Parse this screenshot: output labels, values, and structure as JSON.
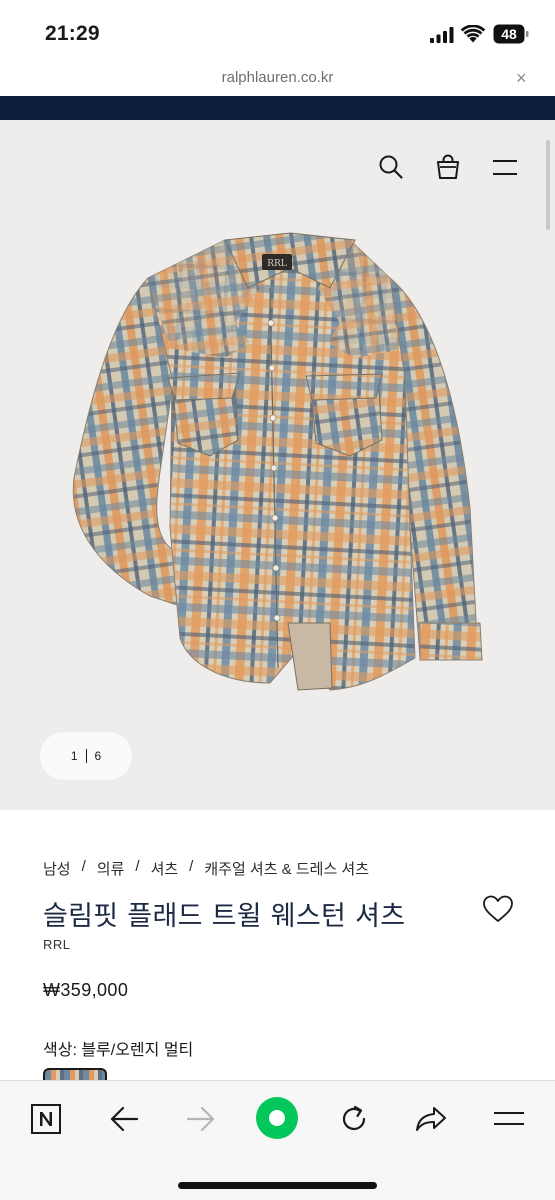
{
  "status_bar": {
    "time": "21:29",
    "battery": "48"
  },
  "url_bar": {
    "domain": "ralphlauren.co.kr",
    "close_glyph": "×"
  },
  "hero": {
    "icons": [
      "search-icon",
      "shopping-bag-icon",
      "menu-icon"
    ],
    "pager": {
      "current": "1",
      "total": "6"
    }
  },
  "product": {
    "breadcrumb": [
      "남성",
      "의류",
      "셔츠",
      "캐주얼 셔츠 & 드레스 셔츠"
    ],
    "breadcrumb_separator": "/",
    "title": "슬림핏 플래드 트윌 웨스턴 셔츠",
    "brand": "RRL",
    "price": "₩359,000",
    "color_label": "색상: 블루/오렌지 멀티"
  },
  "toolbar": {
    "icons": [
      "naver-icon",
      "back-arrow-icon",
      "forward-arrow-icon",
      "green-home-icon",
      "refresh-icon",
      "share-icon",
      "menu-icon"
    ]
  },
  "colors": {
    "navy": "#0b1f3d",
    "hero_bg": "#efedec",
    "accent_green": "#03c75a",
    "title": "#1d2a44"
  }
}
